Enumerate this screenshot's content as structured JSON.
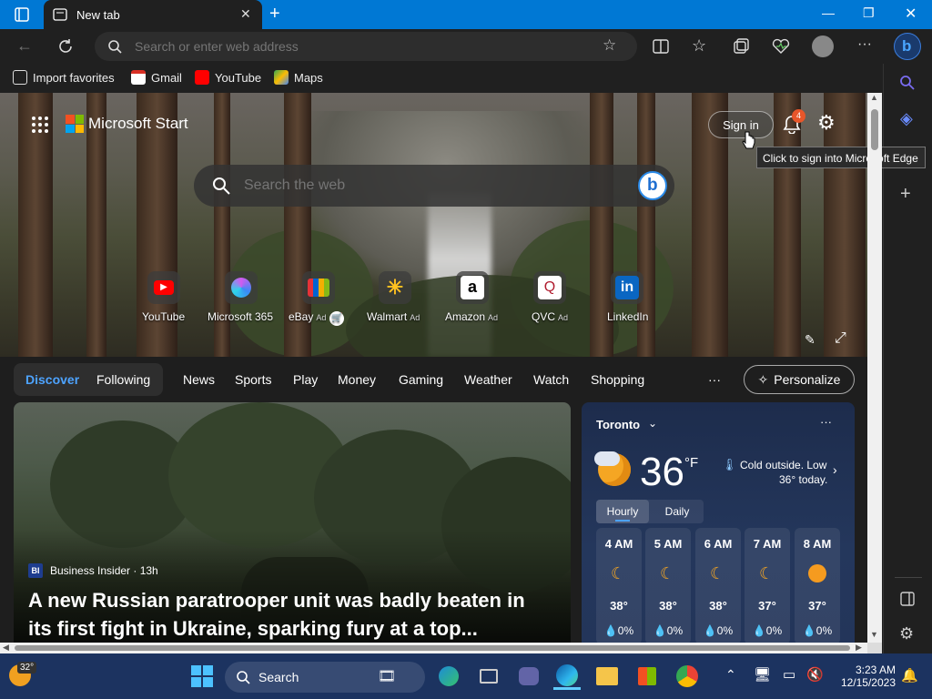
{
  "browser": {
    "tab_title": "New tab",
    "address_placeholder": "Search or enter web address",
    "favorites": [
      {
        "label": "Import favorites"
      },
      {
        "label": "Gmail"
      },
      {
        "label": "YouTube"
      },
      {
        "label": "Maps"
      }
    ]
  },
  "header": {
    "brand": "Microsoft Start",
    "sign_in": "Sign in",
    "notification_count": "4",
    "tooltip": "Click to sign into Microsoft Edge"
  },
  "search": {
    "placeholder": "Search the web"
  },
  "quick_links": [
    {
      "label": "YouTube",
      "ad": ""
    },
    {
      "label": "Microsoft 365",
      "ad": ""
    },
    {
      "label": "eBay",
      "ad": "Ad"
    },
    {
      "label": "Walmart",
      "ad": "Ad"
    },
    {
      "label": "Amazon",
      "ad": "Ad"
    },
    {
      "label": "QVC",
      "ad": "Ad"
    },
    {
      "label": "LinkedIn",
      "ad": ""
    }
  ],
  "nav": {
    "discover": "Discover",
    "following": "Following",
    "items": [
      "News",
      "Sports",
      "Play",
      "Money",
      "Gaming",
      "Weather",
      "Watch",
      "Shopping"
    ],
    "more": "···",
    "personalize": "Personalize"
  },
  "news": {
    "source_logo": "BI",
    "source": "Business Insider · 13h",
    "headline_line1": "A new Russian paratrooper unit was badly beaten in",
    "headline_line2": "its first fight in Ukraine, sparking fury at a top..."
  },
  "weather": {
    "city": "Toronto",
    "temp": "36",
    "unit": "°F",
    "note_line1": "Cold outside. Low",
    "note_line2": "36° today.",
    "tabs": [
      "Hourly",
      "Daily"
    ],
    "more": "···",
    "hours": [
      {
        "time": "4 AM",
        "temp": "38°",
        "precip": "0%",
        "icon": "moon-icon"
      },
      {
        "time": "5 AM",
        "temp": "38°",
        "precip": "0%",
        "icon": "moon-icon"
      },
      {
        "time": "6 AM",
        "temp": "38°",
        "precip": "0%",
        "icon": "moon-icon"
      },
      {
        "time": "7 AM",
        "temp": "37°",
        "precip": "0%",
        "icon": "moon-icon"
      },
      {
        "time": "8 AM",
        "temp": "37°",
        "precip": "0%",
        "icon": "sun-icon"
      }
    ]
  },
  "taskbar": {
    "weather_temp": "32°",
    "search_label": "Search",
    "time": "3:23 AM",
    "date": "12/15/2023"
  },
  "colors": {
    "edge_blue": "#0078d4",
    "accent_discover": "#4da3ff",
    "notification_badge": "#e8562a",
    "taskbar": "#1c3360"
  }
}
